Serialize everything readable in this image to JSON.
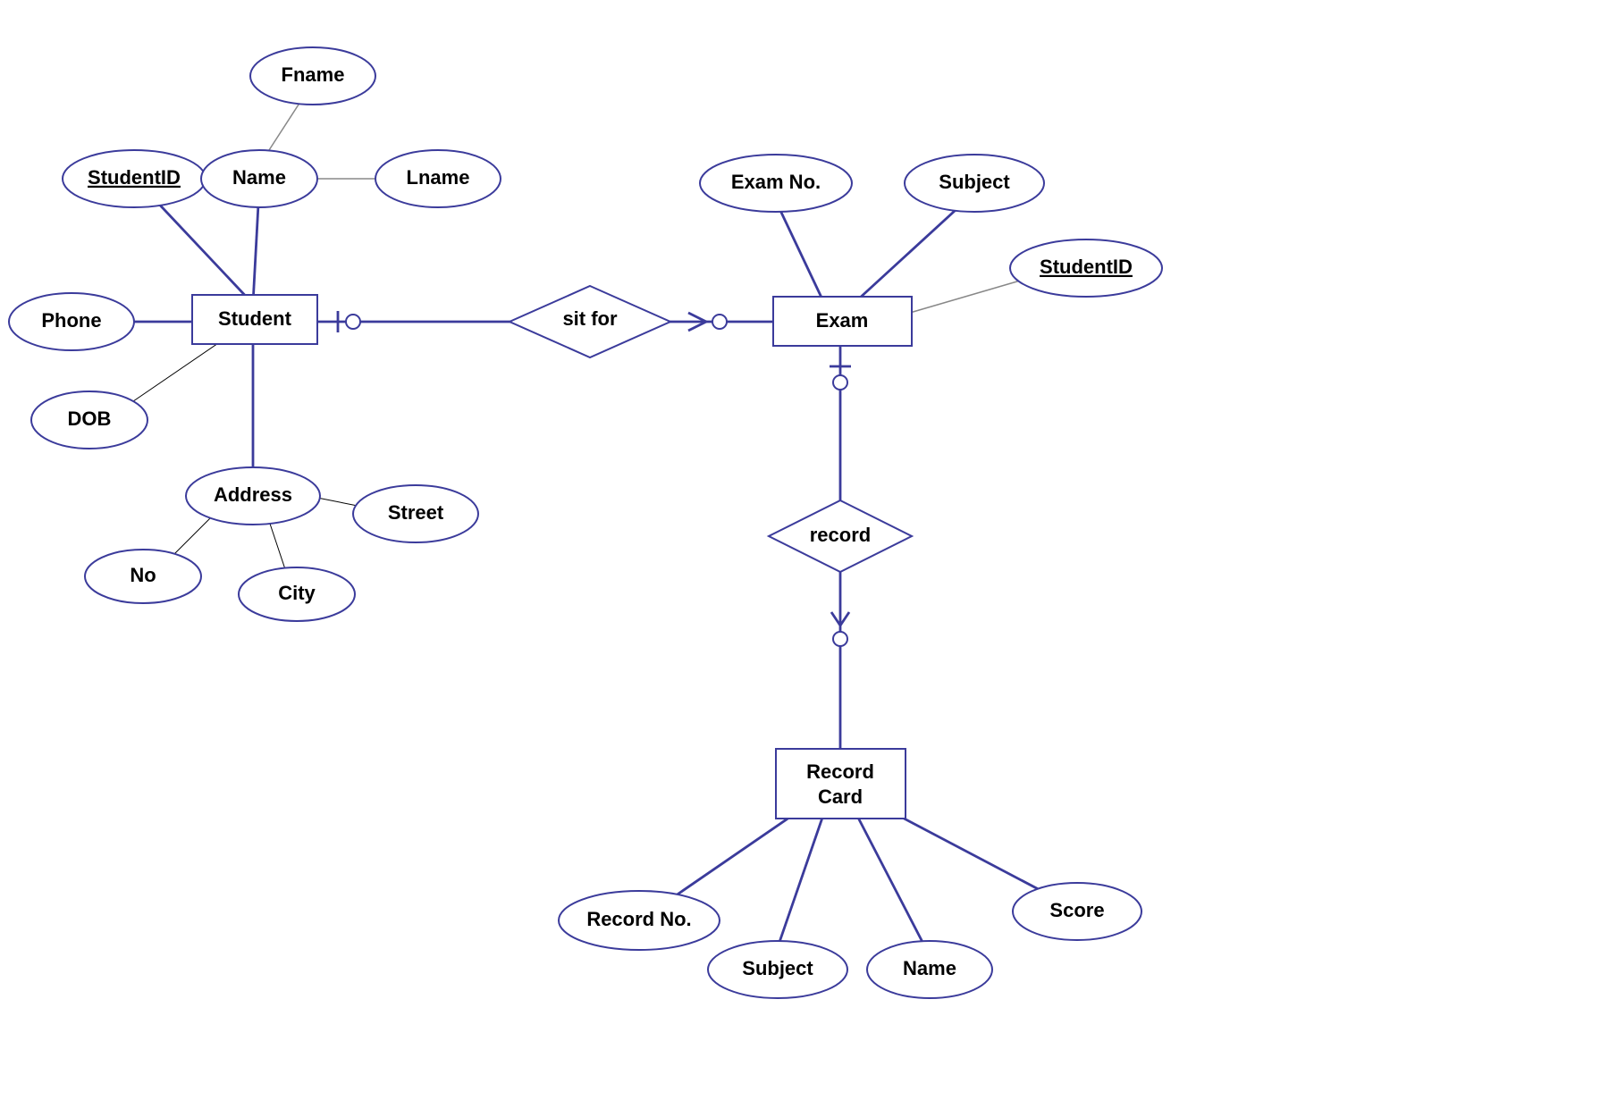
{
  "entities": {
    "student": "Student",
    "exam": "Exam",
    "recordcard_l1": "Record",
    "recordcard_l2": "Card"
  },
  "relationships": {
    "sitfor": "sit for",
    "record": "record"
  },
  "attributes": {
    "student_id": "StudentID",
    "name": "Name",
    "fname": "Fname",
    "lname": "Lname",
    "phone": "Phone",
    "dob": "DOB",
    "address": "Address",
    "no": "No",
    "city": "City",
    "street": "Street",
    "examno": "Exam No.",
    "subject_exam": "Subject",
    "studentid_exam": "StudentID",
    "recordno": "Record No.",
    "subject_rc": "Subject",
    "name_rc": "Name",
    "score": "Score"
  }
}
